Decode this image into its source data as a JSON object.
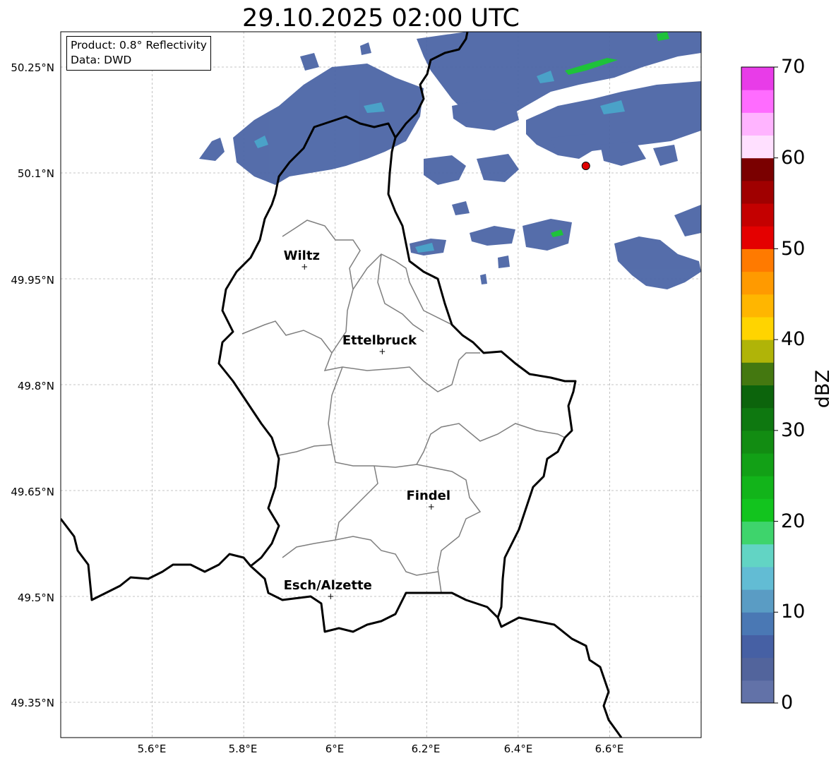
{
  "title": "29.10.2025 02:00 UTC",
  "info": {
    "product": "Product: 0.8° Reflectivity",
    "data": "Data: DWD"
  },
  "axes": {
    "lat_ticks": [
      "50.25°N",
      "50.1°N",
      "49.95°N",
      "49.8°N",
      "49.65°N",
      "49.5°N",
      "49.35°N"
    ],
    "lon_ticks": [
      "5.6°E",
      "5.8°E",
      "6°E",
      "6.2°E",
      "6.4°E",
      "6.6°E"
    ],
    "lon_range": [
      5.4,
      6.8
    ],
    "lat_range": [
      49.3,
      50.3
    ],
    "grid": true
  },
  "cities": [
    {
      "name": "Wiltz",
      "lon": 5.933,
      "lat": 49.967
    },
    {
      "name": "Ettelbruck",
      "lon": 6.103,
      "lat": 49.847
    },
    {
      "name": "Findel",
      "lon": 6.21,
      "lat": 49.627
    },
    {
      "name": "Esch/Alzette",
      "lon": 5.99,
      "lat": 49.5
    }
  ],
  "radar_site": {
    "lon": 6.548,
    "lat": 50.11,
    "color": "#e00000"
  },
  "colorbar": {
    "label": "dBZ",
    "range": [
      0,
      70
    ],
    "ticks": [
      "0",
      "10",
      "20",
      "30",
      "40",
      "50",
      "60",
      "70"
    ],
    "colors": [
      "#6272a8",
      "#52649c",
      "#4660a4",
      "#4a78b4",
      "#5a9cc4",
      "#62bcd4",
      "#62d4c4",
      "#3ed46c",
      "#12c41e",
      "#12b41a",
      "#12a016",
      "#128c12",
      "#0e7810",
      "#0c640c",
      "#447810",
      "#b0b408",
      "#ffd400",
      "#ffb600",
      "#ff9a00",
      "#ff7a00",
      "#e40000",
      "#c40000",
      "#a00000",
      "#7a0000",
      "#ffe0ff",
      "#ffb4ff",
      "#ff6cff",
      "#e83ce8"
    ]
  },
  "chart_data": {
    "type": "heatmap",
    "title": "29.10.2025 02:00 UTC",
    "xlabel": "",
    "ylabel": "",
    "xlim": [
      5.4,
      6.8
    ],
    "ylim": [
      49.3,
      50.3
    ],
    "value_label": "dBZ",
    "value_range": [
      0,
      70
    ],
    "echo_regions": [
      {
        "area": "north-west band",
        "lon": [
          5.7,
          6.18
        ],
        "lat": [
          50.1,
          50.24
        ],
        "dBZ": [
          2,
          14
        ]
      },
      {
        "area": "north-east band",
        "lon": [
          6.35,
          6.8
        ],
        "lat": [
          50.18,
          50.3
        ],
        "dBZ": [
          4,
          24
        ]
      },
      {
        "area": "east scattered",
        "lon": [
          6.2,
          6.8
        ],
        "lat": [
          49.93,
          50.15
        ],
        "dBZ": [
          2,
          14
        ]
      }
    ]
  }
}
